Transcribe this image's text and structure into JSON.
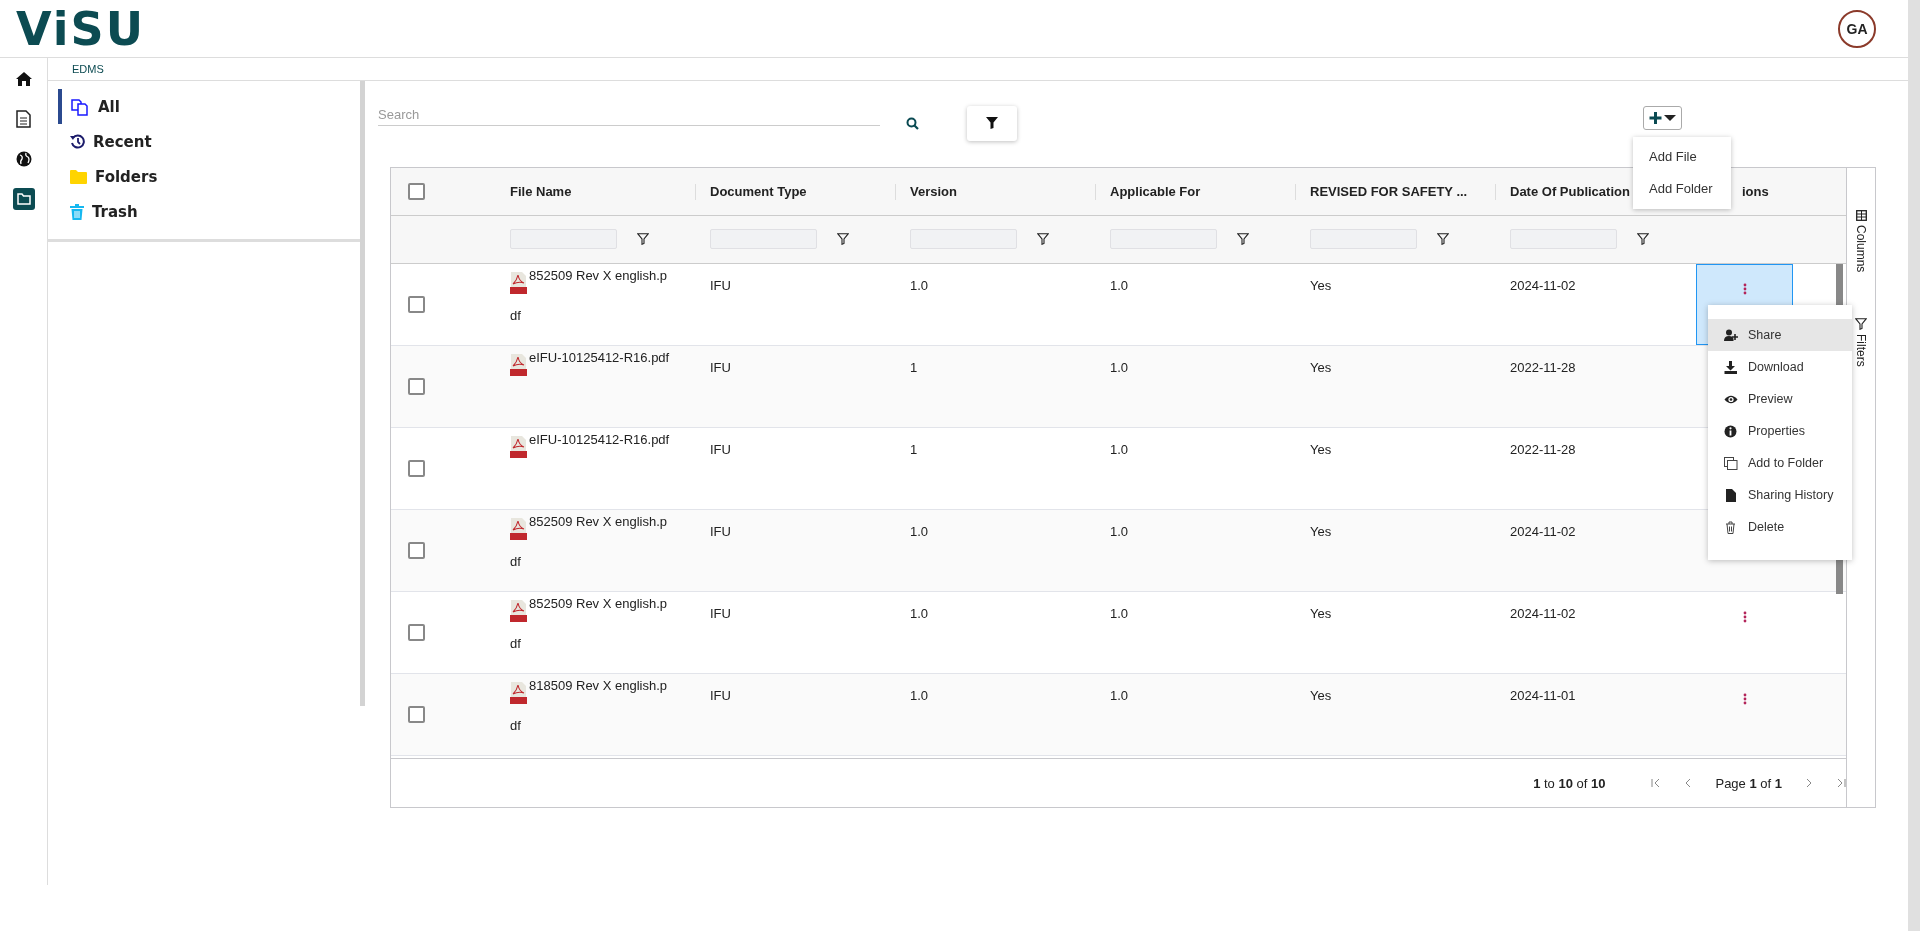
{
  "header": {
    "logo": "ViSU",
    "avatar": "GA"
  },
  "nav_rail": [
    {
      "kind": "home",
      "selected": false
    },
    {
      "kind": "document",
      "selected": false
    },
    {
      "kind": "globe",
      "selected": false
    },
    {
      "kind": "folder",
      "selected": true
    }
  ],
  "breadcrumb": "EDMS",
  "sidebar": {
    "items": [
      {
        "label": "All",
        "kind": "all",
        "selected": true
      },
      {
        "label": "Recent",
        "kind": "recent",
        "selected": false
      },
      {
        "label": "Folders",
        "kind": "folders",
        "selected": false
      },
      {
        "label": "Trash",
        "kind": "trash",
        "selected": false
      }
    ]
  },
  "toolbar": {
    "search": {
      "placeholder": "Search"
    }
  },
  "add_menu": {
    "items": [
      "Add File",
      "Add Folder"
    ]
  },
  "table": {
    "header_checked": false,
    "columns": [
      "File Name",
      "Document Type",
      "Version",
      "Applicable For",
      "REVISED FOR SAFETY ...",
      "Date Of Publication",
      "ions"
    ],
    "rows": [
      {
        "checked": false,
        "file_name": "852509 Rev X english.pdf",
        "document_type": "IFU",
        "version": "1.0",
        "applicable_for": "1.0",
        "revised_for_safety": "Yes",
        "date": "2024-11-02",
        "actions_selected": true
      },
      {
        "checked": false,
        "file_name": "eIFU-10125412-R16.pdf",
        "document_type": "IFU",
        "version": "1",
        "applicable_for": "1.0",
        "revised_for_safety": "Yes",
        "date": "2022-11-28",
        "actions_selected": false
      },
      {
        "checked": false,
        "file_name": "eIFU-10125412-R16.pdf",
        "document_type": "IFU",
        "version": "1",
        "applicable_for": "1.0",
        "revised_for_safety": "Yes",
        "date": "2022-11-28",
        "actions_selected": false
      },
      {
        "checked": false,
        "file_name": "852509 Rev X english.pdf",
        "document_type": "IFU",
        "version": "1.0",
        "applicable_for": "1.0",
        "revised_for_safety": "Yes",
        "date": "2024-11-02",
        "actions_selected": false
      },
      {
        "checked": false,
        "file_name": "852509 Rev X english.pdf",
        "document_type": "IFU",
        "version": "1.0",
        "applicable_for": "1.0",
        "revised_for_safety": "Yes",
        "date": "2024-11-02",
        "actions_selected": false
      },
      {
        "checked": false,
        "file_name": "818509 Rev X english.pdf",
        "document_type": "IFU",
        "version": "1.0",
        "applicable_for": "1.0",
        "revised_for_safety": "Yes",
        "date": "2024-11-01",
        "actions_selected": false
      }
    ],
    "side_tabs": [
      {
        "label": "Columns",
        "kind": "columns"
      },
      {
        "label": "Filters",
        "kind": "filters"
      }
    ],
    "pagination": {
      "summary": "**1** to **10** of **10**",
      "page": "Page **1** of **1**"
    }
  },
  "row_menu": {
    "items": [
      {
        "label": "Share",
        "kind": "share",
        "selected": true
      },
      {
        "label": "Download",
        "kind": "download",
        "selected": false
      },
      {
        "label": "Preview",
        "kind": "preview",
        "selected": false
      },
      {
        "label": "Properties",
        "kind": "properties",
        "selected": false
      },
      {
        "label": "Add to Folder",
        "kind": "add-to-folder",
        "selected": false
      },
      {
        "label": "Sharing History",
        "kind": "sharing-history",
        "selected": false
      },
      {
        "label": "Delete",
        "kind": "delete",
        "selected": false
      }
    ]
  }
}
